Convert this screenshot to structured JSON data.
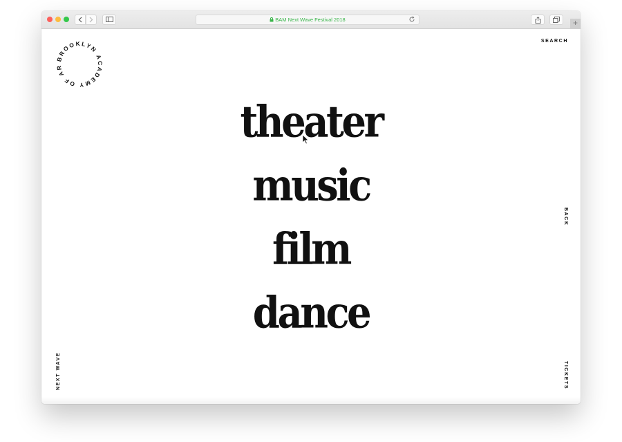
{
  "browser": {
    "address": "BAM Next Wave Festival 2018",
    "new_tab_symbol": "+",
    "icons": [
      "back-icon",
      "forward-icon",
      "sidebar-icon",
      "lock-icon",
      "reload-icon",
      "share-icon",
      "tabs-icon"
    ]
  },
  "logo": {
    "text": "BROOKLYN ACADEMY OF ARTS"
  },
  "nav": {
    "search": "SEARCH",
    "back": "BACK",
    "tickets": "TICKETS",
    "next_wave": "NEXT WAVE"
  },
  "categories": {
    "items": [
      "theater",
      "music",
      "film",
      "dance"
    ]
  },
  "colors": {
    "address_text": "#39b54a",
    "text": "#111111"
  }
}
